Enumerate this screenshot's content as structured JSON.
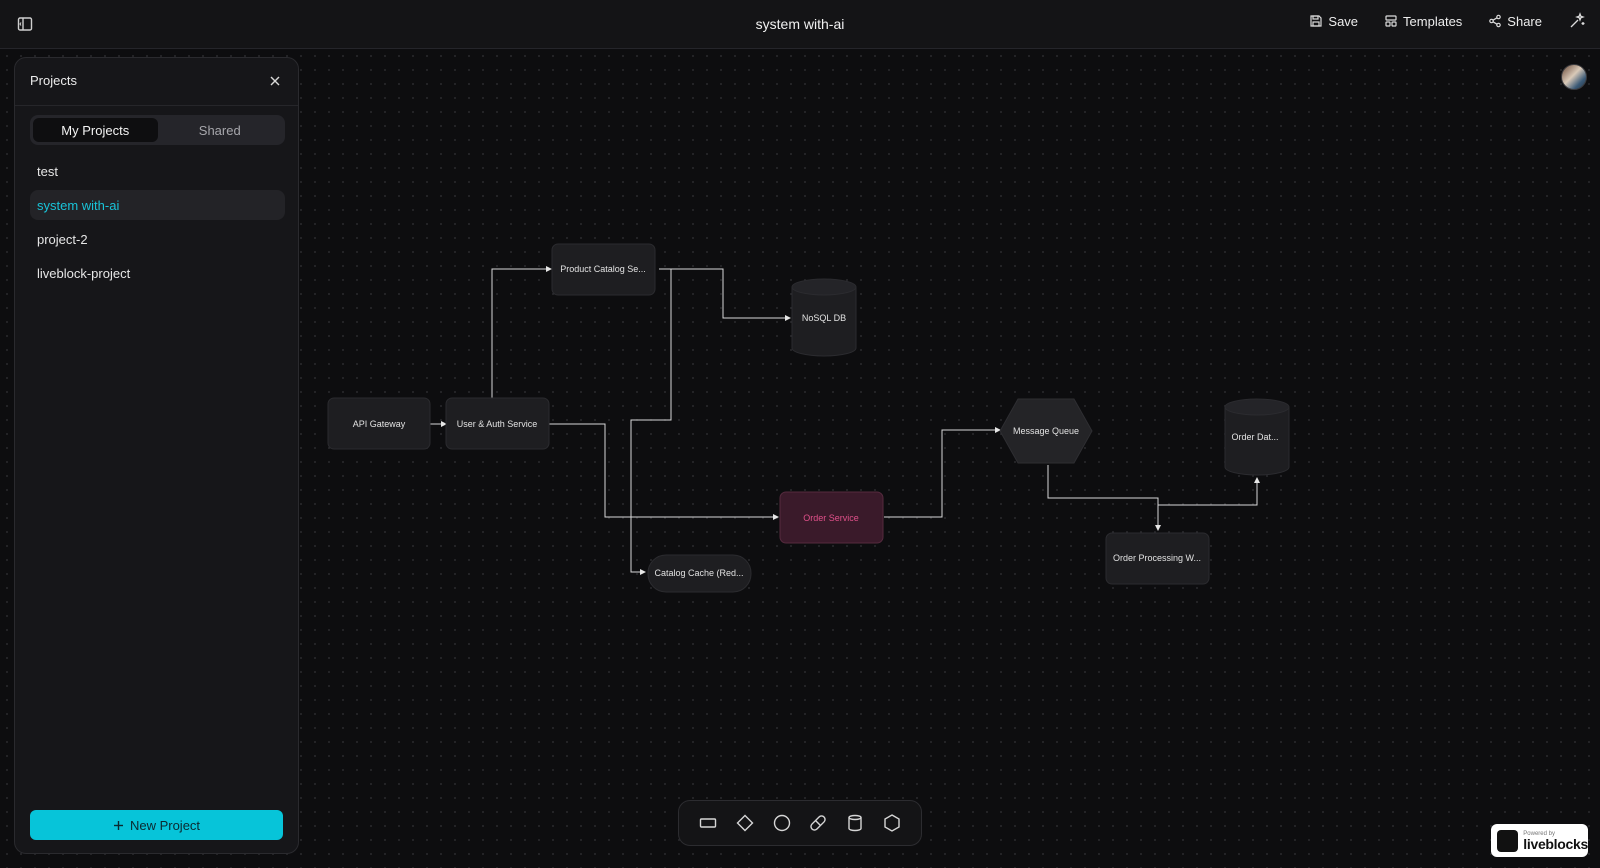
{
  "header": {
    "title": "system with-ai",
    "actions": {
      "save": "Save",
      "templates": "Templates",
      "share": "Share"
    }
  },
  "projects_panel": {
    "title": "Projects",
    "tabs": [
      {
        "label": "My Projects",
        "active": true
      },
      {
        "label": "Shared",
        "active": false
      }
    ],
    "items": [
      {
        "label": "test",
        "active": false
      },
      {
        "label": "system with-ai",
        "active": true
      },
      {
        "label": "project-2",
        "active": false
      },
      {
        "label": "liveblock-project",
        "active": false
      }
    ],
    "new_project_label": "New Project"
  },
  "diagram": {
    "nodes": [
      {
        "id": "api-gateway",
        "label": "API Gateway",
        "shape": "rectangle"
      },
      {
        "id": "user-auth",
        "label": "User & Auth Service",
        "shape": "rectangle"
      },
      {
        "id": "product-catalog",
        "label": "Product Catalog Se...",
        "shape": "rectangle"
      },
      {
        "id": "nosql-db",
        "label": "NoSQL DB",
        "shape": "cylinder"
      },
      {
        "id": "catalog-cache",
        "label": "Catalog Cache (Red...",
        "shape": "pill"
      },
      {
        "id": "order-service",
        "label": "Order Service",
        "shape": "rectangle"
      },
      {
        "id": "message-queue",
        "label": "Message Queue",
        "shape": "hexagon"
      },
      {
        "id": "order-processing",
        "label": "Order Processing W...",
        "shape": "rectangle"
      },
      {
        "id": "order-db",
        "label": "Order Dat...",
        "shape": "cylinder"
      }
    ]
  },
  "toolbar": {
    "tools": [
      "rectangle-tool",
      "diamond-tool",
      "circle-tool",
      "pill-tool",
      "cylinder-tool",
      "hexagon-tool"
    ]
  },
  "badge": {
    "powered_by": "Powered by",
    "brand": "liveblocks"
  },
  "colors": {
    "accent": "#07c4d9",
    "active_text": "#19c3d8",
    "order_service_fill": "#3a1a2a",
    "order_service_text": "#e0508a",
    "node_fill": "#1e1e21"
  }
}
